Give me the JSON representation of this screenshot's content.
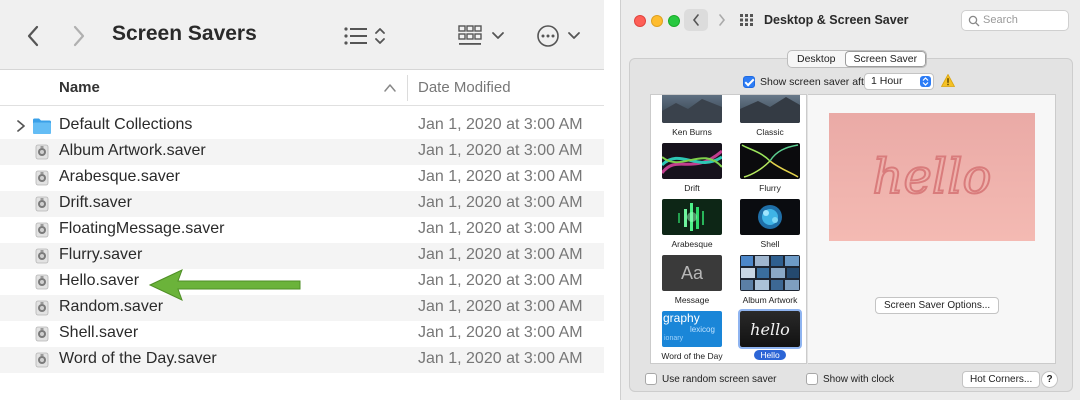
{
  "finder": {
    "title": "Screen Savers",
    "columns": {
      "name": "Name",
      "date": "Date Modified"
    },
    "rows": [
      {
        "name": "Default Collections",
        "date": "Jan 1, 2020 at 3:00 AM",
        "kind": "folder"
      },
      {
        "name": "Album Artwork.saver",
        "date": "Jan 1, 2020 at 3:00 AM",
        "kind": "saver"
      },
      {
        "name": "Arabesque.saver",
        "date": "Jan 1, 2020 at 3:00 AM",
        "kind": "saver"
      },
      {
        "name": "Drift.saver",
        "date": "Jan 1, 2020 at 3:00 AM",
        "kind": "saver"
      },
      {
        "name": "FloatingMessage.saver",
        "date": "Jan 1, 2020 at 3:00 AM",
        "kind": "saver"
      },
      {
        "name": "Flurry.saver",
        "date": "Jan 1, 2020 at 3:00 AM",
        "kind": "saver"
      },
      {
        "name": "Hello.saver",
        "date": "Jan 1, 2020 at 3:00 AM",
        "kind": "saver"
      },
      {
        "name": "Random.saver",
        "date": "Jan 1, 2020 at 3:00 AM",
        "kind": "saver"
      },
      {
        "name": "Shell.saver",
        "date": "Jan 1, 2020 at 3:00 AM",
        "kind": "saver"
      },
      {
        "name": "Word of the Day.saver",
        "date": "Jan 1, 2020 at 3:00 AM",
        "kind": "saver"
      }
    ],
    "arrow_color": "#6bb33a"
  },
  "prefs": {
    "title": "Desktop & Screen Saver",
    "search_placeholder": "Search",
    "tabs": [
      {
        "label": "Desktop"
      },
      {
        "label": "Screen Saver"
      }
    ],
    "selected_tab": "Screen Saver",
    "show_after_label": "Show screen saver after",
    "show_after_checked": true,
    "show_after_value": "1 Hour",
    "modules": [
      {
        "label": "Ken Burns"
      },
      {
        "label": "Classic"
      },
      {
        "label": "Drift"
      },
      {
        "label": "Flurry"
      },
      {
        "label": "Arabesque"
      },
      {
        "label": "Shell"
      },
      {
        "label": "Message"
      },
      {
        "label": "Album Artwork"
      },
      {
        "label": "Word of the Day"
      },
      {
        "label": "Hello"
      }
    ],
    "selected_module": "Hello",
    "thumb_message_text": "Aa",
    "thumb_word_text": "graphy",
    "thumb_word_small_1": "lexicog",
    "thumb_word_small_2": "ionary",
    "thumb_hello_text": "hello",
    "preview_text": "hello",
    "options_button": "Screen Saver Options...",
    "random_label": "Use random screen saver",
    "random_checked": false,
    "clock_label": "Show with clock",
    "clock_checked": false,
    "hot_corners_button": "Hot Corners...",
    "help_button": "?",
    "accent_color": "#2c7cf6"
  }
}
